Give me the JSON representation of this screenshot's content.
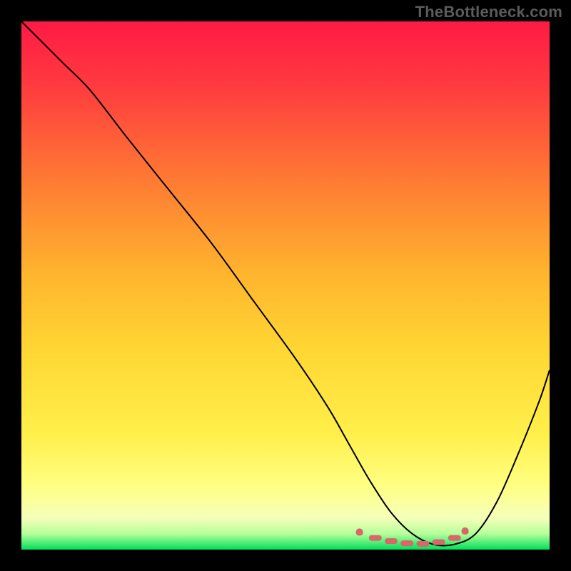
{
  "watermark": "TheBottleneck.com",
  "colors": {
    "bg": "#000000",
    "curve": "#000000",
    "marker": "#d9676a",
    "grad_top": "#ff1a45",
    "grad_mid1": "#ff7a33",
    "grad_mid2": "#ffd633",
    "grad_low": "#ffff66",
    "grad_pale": "#ffffb0",
    "grad_bottom": "#00e05a"
  },
  "chart_data": {
    "type": "line",
    "title": "",
    "xlabel": "",
    "ylabel": "",
    "xlim": [
      0,
      100
    ],
    "ylim": [
      0,
      100
    ],
    "grid": false,
    "legend": false,
    "series": [
      {
        "name": "bottleneck-curve",
        "x": [
          0,
          4,
          8,
          13,
          20,
          28,
          36,
          44,
          52,
          58,
          62,
          66,
          70,
          74,
          78,
          82,
          86,
          90,
          94,
          98,
          100
        ],
        "y": [
          100,
          96,
          92,
          87,
          78,
          68,
          58,
          47,
          36,
          27,
          20,
          13,
          7,
          3,
          1,
          1,
          3,
          9,
          18,
          28,
          34
        ]
      }
    ],
    "markers": {
      "name": "near-zero-band",
      "x": [
        64,
        67,
        70,
        73,
        76,
        79,
        82,
        84
      ],
      "y": [
        3.2,
        2.2,
        1.6,
        1.2,
        1.1,
        1.4,
        2.2,
        3.4
      ]
    }
  }
}
